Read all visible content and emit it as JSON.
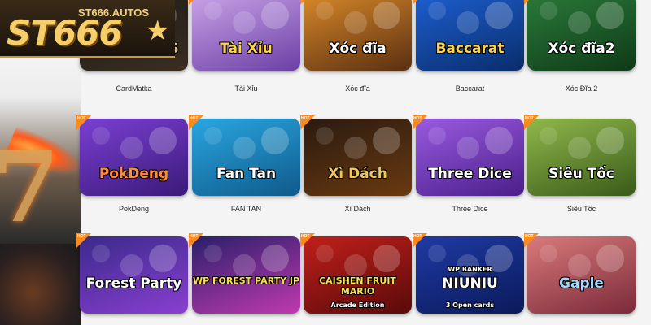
{
  "brand": {
    "name": "ST666",
    "domain": "ST666.AUTOS",
    "star": "★"
  },
  "hot_tag": "HOT",
  "games": [
    {
      "caption": "CardMatka",
      "art": "KINGMIDAS",
      "colors": [
        "#1b1b1b",
        "#3a2e20"
      ],
      "text_color": "#d9c28a",
      "icon": "kingmidas-art"
    },
    {
      "caption": "Tài Xỉu",
      "art": "Tài Xỉu",
      "colors": [
        "#c9a4e8",
        "#6b3fa5"
      ],
      "text_color": "#ffd54a",
      "icon": "dice-art"
    },
    {
      "caption": "Xóc đĩa",
      "art": "Xóc đĩa",
      "colors": [
        "#d9892a",
        "#5a2f10"
      ],
      "text_color": "#ffffff",
      "icon": "xoc-dia-art"
    },
    {
      "caption": "Baccarat",
      "art": "Baccarat",
      "colors": [
        "#1d5fd1",
        "#0a2d6b"
      ],
      "text_color": "#ffd54a",
      "icon": "cards-art"
    },
    {
      "caption": "Xóc Đĩa 2",
      "art": "Xóc đĩa2",
      "colors": [
        "#2b7a3a",
        "#0f3a18"
      ],
      "text_color": "#ffffff",
      "icon": "xoc-dia-2-art"
    },
    {
      "caption": "PokDeng",
      "art": "PokDeng",
      "colors": [
        "#7a3fd1",
        "#3b1a7a"
      ],
      "text_color": "#ff8a3a",
      "icon": "pokdeng-art"
    },
    {
      "caption": "FAN    TAN",
      "art": "Fan Tan",
      "colors": [
        "#2aa6e0",
        "#0f5a8a"
      ],
      "text_color": "#ffffff",
      "icon": "fan-tan-art"
    },
    {
      "caption": "Xì Dách",
      "art": "Xì Dách",
      "colors": [
        "#2a1a10",
        "#6a3a10"
      ],
      "text_color": "#f2c75a",
      "icon": "xi-dach-art"
    },
    {
      "caption": "Three Dice",
      "art": "Three Dice",
      "colors": [
        "#9a5ae0",
        "#4a1f8a"
      ],
      "text_color": "#ffffff",
      "icon": "three-dice-art"
    },
    {
      "caption": "Siêu Tốc",
      "art": "Siêu Tốc",
      "colors": [
        "#8fb84a",
        "#3a5a1a"
      ],
      "text_color": "#ffffff",
      "icon": "sieu-toc-art"
    },
    {
      "caption": "",
      "art": "Forest Party",
      "colors": [
        "#3a2a8a",
        "#8a3fd1"
      ],
      "text_color": "#ffffff",
      "icon": "forest-party-art"
    },
    {
      "caption": "",
      "art": "WP FOREST PARTY JP",
      "colors": [
        "#2a1f6a",
        "#c03ab0"
      ],
      "text_color": "#ffe04a",
      "icon": "wp-forest-party-art"
    },
    {
      "caption": "",
      "art": "CAISHEN FRUIT MARIO",
      "colors": [
        "#c0201a",
        "#5a0a0a"
      ],
      "text_color": "#ffe04a",
      "icon": "caishen-art"
    },
    {
      "caption": "",
      "art": "NIUNIU",
      "colors": [
        "#1f3aa5",
        "#0a1a5a"
      ],
      "text_color": "#ffffff",
      "icon": "niuniu-art"
    },
    {
      "caption": "",
      "art": "Gaple",
      "colors": [
        "#d97a7a",
        "#7a2a3a"
      ],
      "text_color": "#a0d8ff",
      "icon": "gaple-art"
    }
  ],
  "sub_art": {
    "wp_banker": "WP BANKER",
    "open_cards": "3 Open cards",
    "arcade": "Arcade Edition"
  }
}
